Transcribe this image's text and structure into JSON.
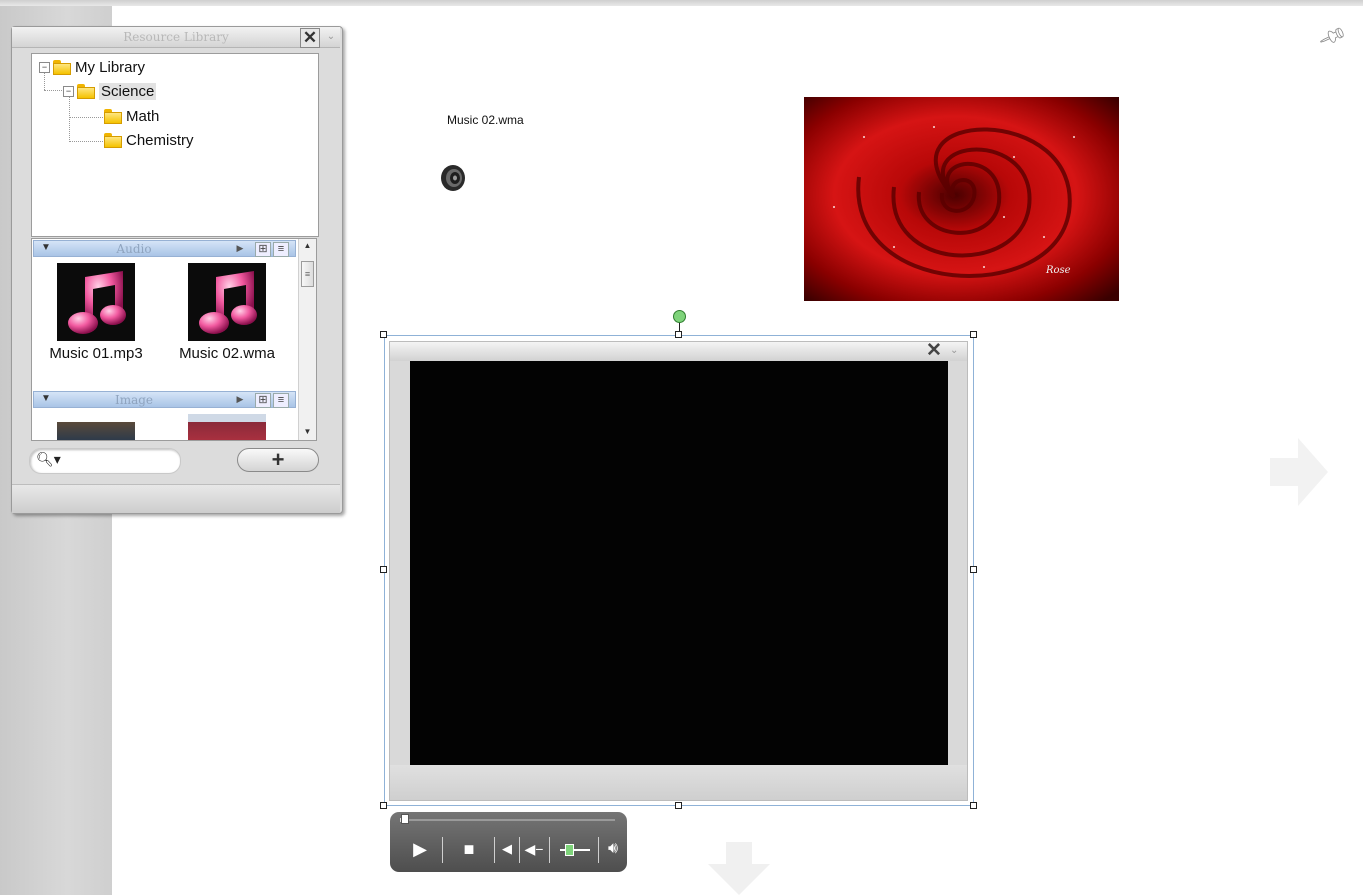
{
  "panel": {
    "title": "Resource Library",
    "tree": {
      "root": "My Library",
      "child": "Science",
      "leaves": [
        "Math",
        "Chemistry"
      ]
    },
    "sections": {
      "audio": "Audio",
      "image": "Image"
    },
    "audio_items": [
      "Music 01.mp3",
      "Music 02.wma"
    ]
  },
  "canvas": {
    "audio_object_label": "Music 02.wma",
    "rose_watermark": "Rose"
  },
  "player": {
    "progress": 0.02,
    "volume": 0.3
  },
  "colors": {
    "accent_green": "#7ed37a",
    "selection_blue": "#8fb2d7",
    "section_header": "#a9c4e6"
  }
}
